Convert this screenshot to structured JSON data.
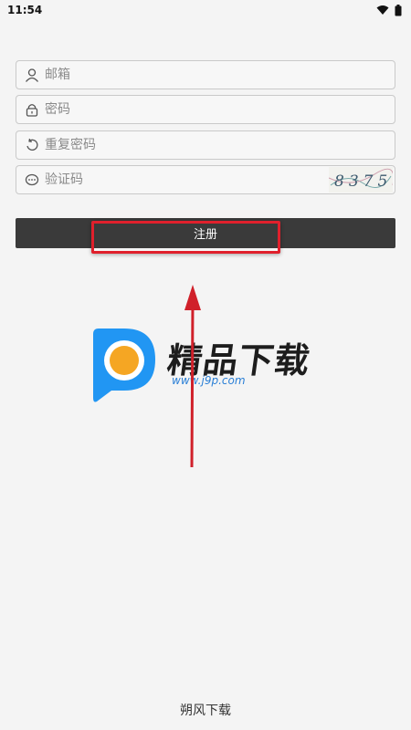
{
  "status_bar": {
    "time": "11:54"
  },
  "form": {
    "email_placeholder": "邮箱",
    "password_placeholder": "密码",
    "repeat_password_placeholder": "重复密码",
    "captcha_placeholder": "验证码",
    "captcha_text": "8375",
    "register_label": "注册"
  },
  "watermark": {
    "title": "精品下载",
    "url": "www.j9p.com"
  },
  "footer": {
    "text": "朔风下载"
  },
  "colors": {
    "button_bg": "#3a3a3a",
    "highlight": "#e0202c",
    "logo_blue": "#2196f3",
    "logo_orange": "#f5a623"
  }
}
